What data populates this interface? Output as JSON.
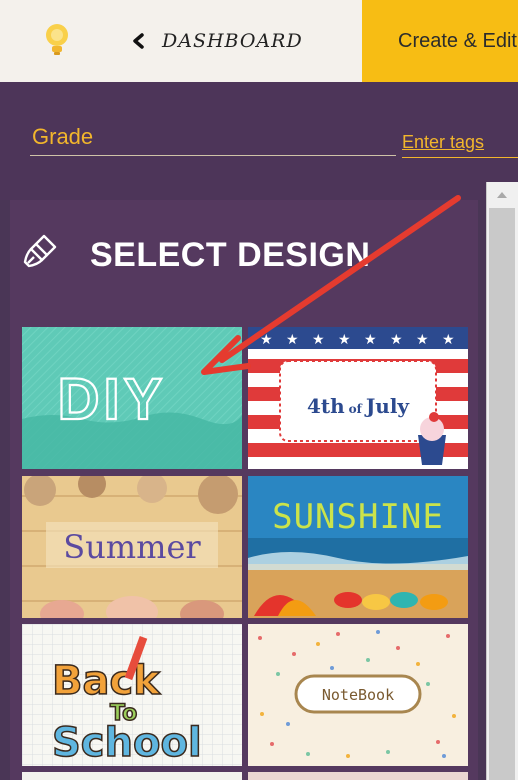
{
  "topbar": {
    "bulb_icon": "lightbulb-icon",
    "dashboard_label": "DASHBOARD",
    "create_tab_label": "Create & Edit"
  },
  "form": {
    "grade_placeholder": "Grade",
    "tags_placeholder": "Enter tags"
  },
  "panel": {
    "title": "SELECT DESIGN",
    "icon": "paintbrush-icon",
    "designs": [
      {
        "id": "diy",
        "label": "DIY"
      },
      {
        "id": "july4",
        "label_main": "4th",
        "label_of": "of",
        "label_end": "July"
      },
      {
        "id": "summer",
        "label": "Summer"
      },
      {
        "id": "sunshine",
        "label": "SUNSHINE"
      },
      {
        "id": "back-to-school",
        "label_1": "Back",
        "label_2": "To",
        "label_3": "School"
      },
      {
        "id": "notebook",
        "label": "NoteBook"
      }
    ]
  },
  "colors": {
    "accent_yellow": "#f7bd14",
    "panel_purple": "#55395f",
    "annotation_red": "#e53b2f"
  }
}
